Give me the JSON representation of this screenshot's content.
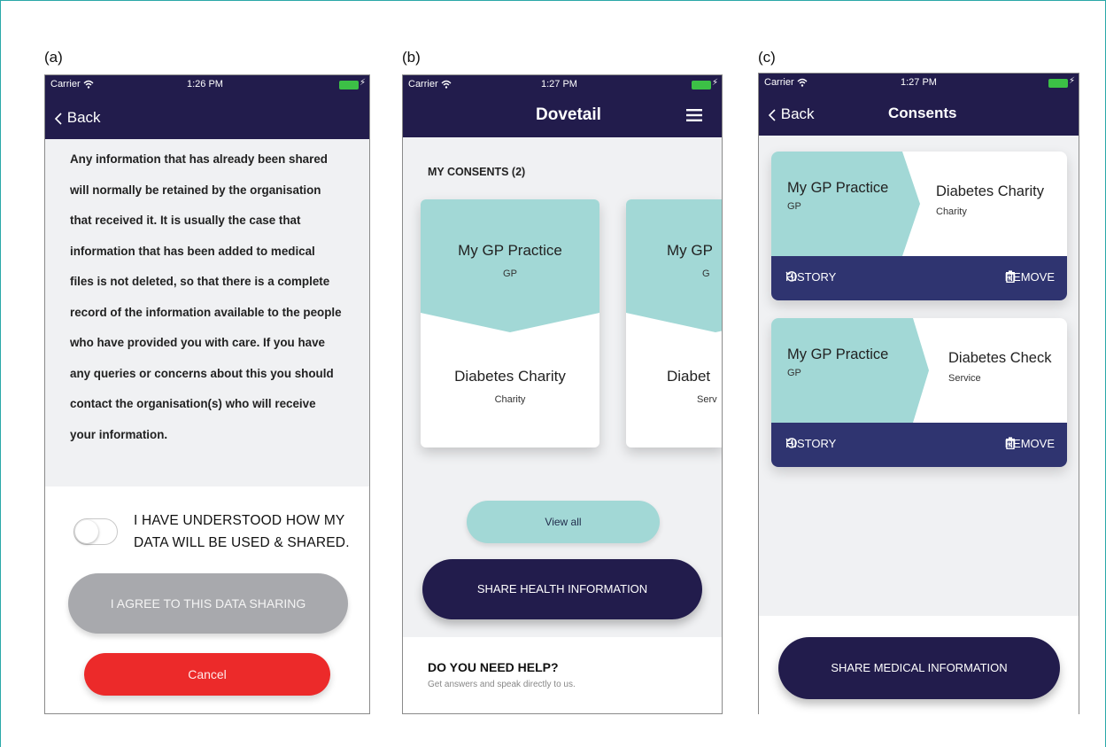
{
  "labels": {
    "a": "(a)",
    "b": "(b)",
    "c": "(c)"
  },
  "status": {
    "carrier": "Carrier",
    "time_a": "1:26 PM",
    "time_b": "1:27 PM",
    "time_c": "1:27 PM"
  },
  "panel_a": {
    "nav_back": "Back",
    "body_lines": [
      "Any information that has already been shared",
      "will normally be retained by the organisation",
      "that received it. It is usually the case that",
      "information that has been added to medical",
      "files is not deleted, so that there is a complete",
      "record of the information available to the people",
      "who have provided you with care. If you have",
      "any queries or concerns about this you should",
      "contact the organisation(s) who will receive",
      "your information."
    ],
    "toggle_line1": "I HAVE UNDERSTOOD HOW MY",
    "toggle_line2": "DATA WILL BE USED & SHARED.",
    "agree_label": "I AGREE TO THIS DATA SHARING",
    "cancel_label": "Cancel"
  },
  "panel_b": {
    "title": "Dovetail",
    "section_title": "MY CONSENTS (2)",
    "card1": {
      "from": "My GP Practice",
      "from_type": "GP",
      "to": "Diabetes Charity",
      "to_type": "Charity"
    },
    "card2": {
      "from": "My GP",
      "from_type": "G",
      "to": "Diabet",
      "to_type": "Serv"
    },
    "view_all": "View all",
    "share_label": "SHARE HEALTH INFORMATION",
    "help_title": "DO YOU NEED HELP?",
    "help_sub": "Get answers and speak directly to us."
  },
  "panel_c": {
    "nav_back": "Back",
    "title": "Consents",
    "consents": [
      {
        "from": "My GP Practice",
        "from_type": "GP",
        "to": "Diabetes Charity",
        "to_type": "Charity",
        "history": "HISTORY",
        "remove": "REMOVE"
      },
      {
        "from": "My GP Practice",
        "from_type": "GP",
        "to": "Diabetes Check",
        "to_type": "Service",
        "history": "HISTORY",
        "remove": "REMOVE"
      }
    ],
    "share_label": "SHARE MEDICAL INFORMATION"
  },
  "colors": {
    "navy": "#221c4c",
    "teal": "#a2d8d6",
    "red": "#ec2a2a",
    "grey_button": "#a8a9ad",
    "action_bar": "#2f3470"
  },
  "icons": [
    "wifi-icon",
    "battery-icon",
    "chevron-left-icon",
    "hamburger-menu-icon",
    "history-icon",
    "trash-icon",
    "toggle-switch"
  ]
}
